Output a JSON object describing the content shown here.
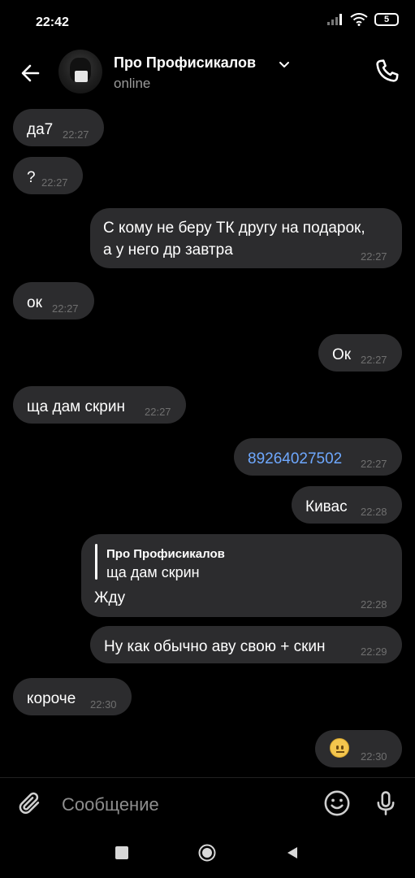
{
  "status_bar": {
    "time": "22:42",
    "battery_level": "5",
    "icons": [
      "signal-icon",
      "wifi-icon",
      "battery-icon"
    ]
  },
  "header": {
    "title": "Про Профисикалов",
    "status": "online",
    "icons": [
      "back-arrow-icon",
      "avatar",
      "chevron-down-icon",
      "phone-icon"
    ]
  },
  "messages": [
    {
      "direction": "in",
      "text": "да7",
      "time": "22:27"
    },
    {
      "direction": "in",
      "text": "?",
      "time": "22:27"
    },
    {
      "direction": "out",
      "line1": "С кому не беру ТК другу на подарок,",
      "line2": "а у него др завтра",
      "time": "22:27"
    },
    {
      "direction": "in",
      "text": "ок",
      "time": "22:27"
    },
    {
      "direction": "out",
      "text": "Ок",
      "time": "22:27"
    },
    {
      "direction": "in",
      "text": "ща дам скрин",
      "time": "22:27"
    },
    {
      "direction": "out",
      "text": "89264027502",
      "time": "22:27"
    },
    {
      "direction": "out",
      "text": "Кивас",
      "time": "22:28"
    },
    {
      "direction": "out",
      "reply_name": "Про Профисикалов",
      "reply_text": "ща дам скрин",
      "text": "Жду",
      "time": "22:28"
    },
    {
      "direction": "out",
      "text": "Ну как обычно аву свою + скин",
      "time": "22:29"
    },
    {
      "direction": "in",
      "text": "короче",
      "time": "22:30"
    },
    {
      "direction": "out",
      "emoji": "neutral-face-emoji",
      "time": "22:30"
    }
  ],
  "composer": {
    "placeholder": "Сообщение",
    "icons": [
      "paperclip-icon",
      "smiley-icon",
      "microphone-icon"
    ]
  },
  "nav_bar": {
    "icons": [
      "recents-square-icon",
      "home-circle-icon",
      "back-triangle-icon"
    ]
  },
  "colors": {
    "background": "#000000",
    "bubble": "#2c2c2e",
    "link": "#6ea8ff",
    "time_text": "#6f6f6f"
  }
}
